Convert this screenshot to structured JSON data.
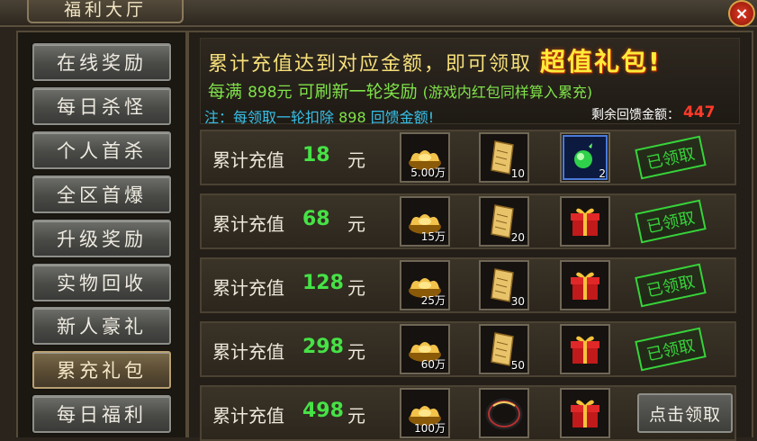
{
  "window": {
    "title": "福利大厅",
    "close_label": "×"
  },
  "nav": {
    "items": [
      {
        "label": "在线奖励"
      },
      {
        "label": "每日杀怪"
      },
      {
        "label": "个人首杀"
      },
      {
        "label": "全区首爆"
      },
      {
        "label": "升级奖励"
      },
      {
        "label": "实物回收"
      },
      {
        "label": "新人豪礼"
      },
      {
        "label": "累充礼包",
        "active": true
      },
      {
        "label": "每日福利"
      }
    ]
  },
  "banner": {
    "line1_main": "累计充值达到对应金额，即可领取",
    "line1_highlight": "超值礼包!",
    "line2_prefix": "每满",
    "line2_amount": "898元",
    "line2_suffix": "可刷新一轮奖励",
    "line2_note": "(游戏内红包同样算入累充)",
    "note_prefix": "注：每领取一轮扣除",
    "note_amount": "898",
    "note_suffix": "回馈金额!",
    "remaining_label": "剩余回馈金额：",
    "remaining_value": "447"
  },
  "rows": [
    {
      "label": "累计充值",
      "amount": "18",
      "unit": "元",
      "rewards": [
        {
          "icon": "gold-ingot-icon",
          "count": "5.00万"
        },
        {
          "icon": "scroll-icon",
          "count": "10"
        },
        {
          "icon": "green-orb-icon",
          "count": "2"
        }
      ],
      "status": "已领取"
    },
    {
      "label": "累计充值",
      "amount": "68",
      "unit": "元",
      "rewards": [
        {
          "icon": "gold-ingot-icon",
          "count": "15万"
        },
        {
          "icon": "scroll-icon",
          "count": "20"
        },
        {
          "icon": "gift-box-icon",
          "count": ""
        }
      ],
      "status": "已领取"
    },
    {
      "label": "累计充值",
      "amount": "128",
      "unit": "元",
      "rewards": [
        {
          "icon": "gold-ingot-icon",
          "count": "25万"
        },
        {
          "icon": "scroll-icon",
          "count": "30"
        },
        {
          "icon": "gift-box-icon",
          "count": ""
        }
      ],
      "status": "已领取"
    },
    {
      "label": "累计充值",
      "amount": "298",
      "unit": "元",
      "rewards": [
        {
          "icon": "gold-ingot-icon",
          "count": "60万"
        },
        {
          "icon": "scroll-icon",
          "count": "50"
        },
        {
          "icon": "gift-box-icon",
          "count": ""
        }
      ],
      "status": "已领取"
    },
    {
      "label": "累计充值",
      "amount": "498",
      "unit": "元",
      "rewards": [
        {
          "icon": "gold-ingot-icon",
          "count": "100万"
        },
        {
          "icon": "ring-icon",
          "count": ""
        },
        {
          "icon": "gift-box-icon",
          "count": ""
        }
      ],
      "status": "点击领取"
    }
  ],
  "colors": {
    "accent_green": "#46e246",
    "remaining_red": "#ff3a2a",
    "note_cyan": "#37c0e8"
  }
}
